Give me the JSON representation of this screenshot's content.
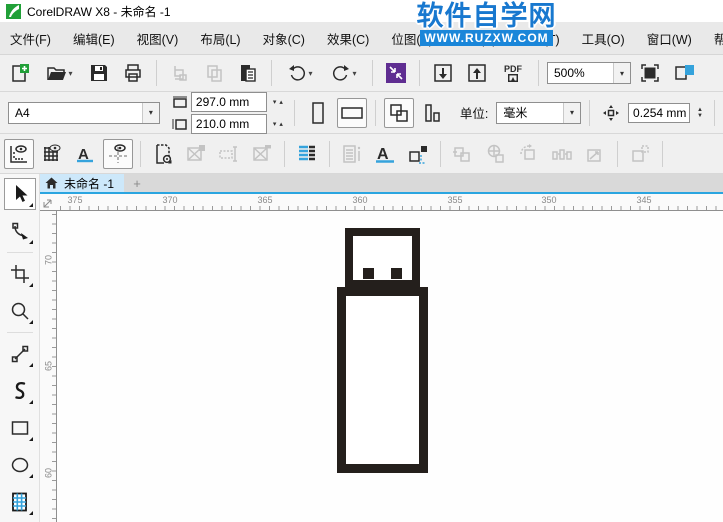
{
  "window": {
    "title": "CorelDRAW X8 - 未命名 -1"
  },
  "watermark": {
    "line1": "软件自学网",
    "line2": "WWW.RUZXW.COM",
    "text_color": "#1878cf",
    "bar_color": "#1a86d9"
  },
  "menu": {
    "items": [
      "文件(F)",
      "编辑(E)",
      "视图(V)",
      "布局(L)",
      "对象(C)",
      "效果(C)",
      "位图(B)",
      "文本(X)",
      "表格(T)",
      "工具(O)",
      "窗口(W)",
      "帮助(H)"
    ]
  },
  "toolbar": {
    "icons": [
      "new-document",
      "open",
      "save",
      "print",
      "cut",
      "copy",
      "paste",
      "undo",
      "redo",
      "welcome-screen",
      "import",
      "export",
      "publish-to-pdf",
      "zoom-levels",
      "full-screen-preview",
      "show-rulers"
    ],
    "pdf_label": "PDF",
    "zoom_value": "500%",
    "accent_purple": "#5f2d91",
    "accent_green": "#21a038"
  },
  "property_bar": {
    "preset_value": "A4",
    "page_width": "297.0 mm",
    "page_height": "210.0 mm",
    "units_label": "单位:",
    "units_value": "毫米",
    "nudge_value": "0.254 mm",
    "icons": [
      "page-width",
      "page-height",
      "portrait",
      "landscape",
      "all-pages",
      "facing-pages",
      "nudge-offset"
    ]
  },
  "toolbar2": {
    "icons": [
      "show-rulers",
      "show-grid",
      "show-baseline-grid",
      "show-guidelines",
      "page-settings",
      "insert-placeholder",
      "text-placeholder",
      "remove-placeholder",
      "text-flow",
      "document-info",
      "text-properties",
      "object-outline",
      "align-objects",
      "combine-objects",
      "rotate-objects",
      "distribute-objects",
      "scale-objects",
      "order-objects"
    ]
  },
  "tabs": {
    "home_icon": "home",
    "active_label": "未命名 -1",
    "new_tab_label": "+",
    "underline_color": "#2aa5e0"
  },
  "rulers": {
    "horizontal_labels": [
      "375",
      "370",
      "365",
      "360",
      "355",
      "350",
      "345"
    ],
    "vertical_labels": [
      "70",
      "65",
      "60"
    ]
  },
  "toolbox": {
    "tools": [
      "pick-tool",
      "shape-tool",
      "crop-tool",
      "zoom-tool",
      "freehand-tool",
      "artistic-media-tool",
      "rectangle-tool",
      "ellipse-tool",
      "table-tool"
    ],
    "selected": "pick-tool"
  },
  "canvas": {
    "drawing": "usb-flash-drive-outline",
    "stroke_color": "#241f1c"
  }
}
